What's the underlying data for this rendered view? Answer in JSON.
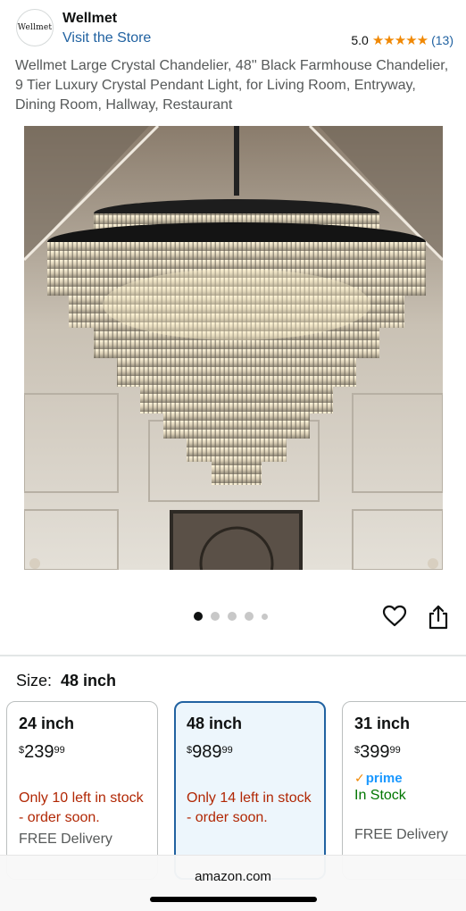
{
  "header": {
    "brand_logo_text": "Wellmet",
    "brand_name": "Wellmet",
    "visit_store": "Visit the Store",
    "rating": "5.0",
    "stars": "★★★★★",
    "rating_count": "(13)"
  },
  "product": {
    "title": "Wellmet Large Crystal Chandelier, 48'' Black Farmhouse Chandelier, 9 Tier Luxury Crystal Pendant Light, for Living Room, Entryway, Dining Room, Hallway, Restaurant",
    "image_count": 5,
    "active_image_index": 0
  },
  "size_selector": {
    "label": "Size:",
    "selected": "48 inch"
  },
  "variants": [
    {
      "name": "24 inch",
      "currency": "$",
      "price_whole": "239",
      "price_cents": "99",
      "stock": "Only 10 left in stock - order soon.",
      "delivery": "FREE Delivery"
    },
    {
      "name": "48 inch",
      "currency": "$",
      "price_whole": "989",
      "price_cents": "99",
      "stock": "Only 14 left in stock - order soon.",
      "selected": true
    },
    {
      "name": "31 inch",
      "currency": "$",
      "price_whole": "399",
      "price_cents": "99",
      "prime": "prime",
      "availability": "In Stock",
      "delivery": "FREE Delivery"
    }
  ],
  "browser": {
    "domain": "amazon.com"
  },
  "colors": {
    "link": "#2162a1",
    "star": "#f08804",
    "warning": "#b12704",
    "in_stock": "#007600",
    "prime": "#1a98ff",
    "selected_border": "#2162a1"
  },
  "icons": [
    "heart-icon",
    "share-icon",
    "prime-check-icon"
  ]
}
